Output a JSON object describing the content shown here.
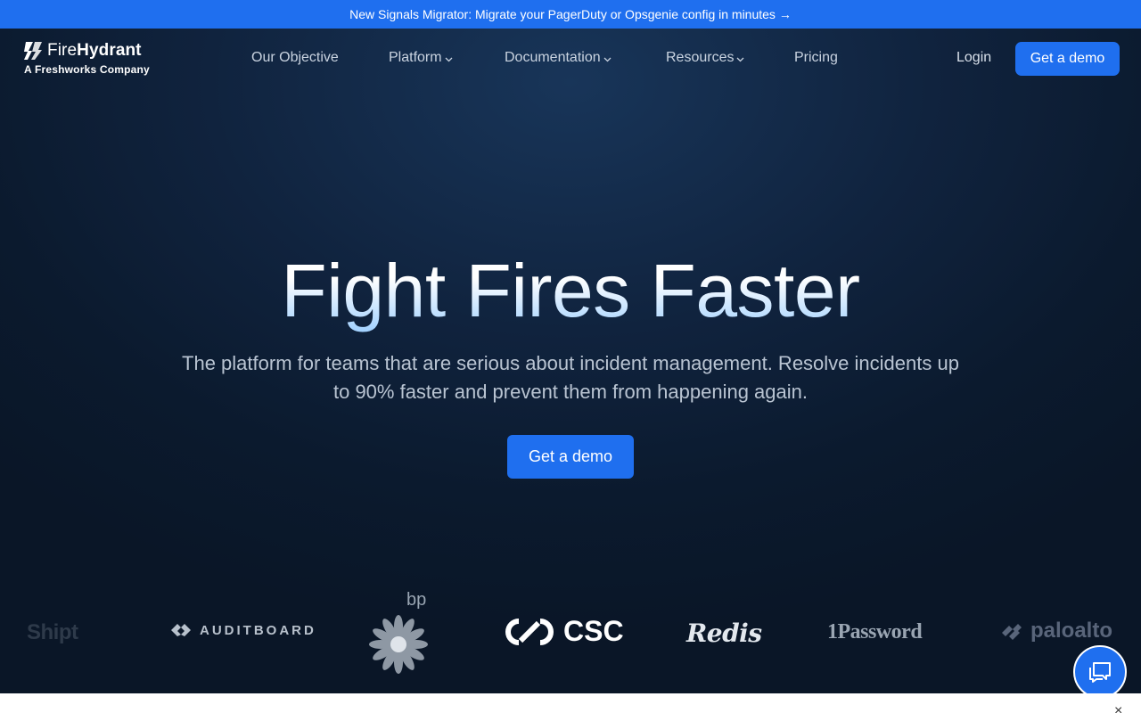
{
  "announcement": {
    "text": "New Signals Migrator: Migrate your PagerDuty or Opsgenie config in minutes →"
  },
  "brand": {
    "name_light": "Fire",
    "name_bold": "Hydrant",
    "tagline": "A Freshworks Company"
  },
  "nav": {
    "items": [
      {
        "label": "Our Objective",
        "has_menu": false
      },
      {
        "label": "Platform",
        "has_menu": true
      },
      {
        "label": "Documentation",
        "has_menu": true
      },
      {
        "label": "Resources",
        "has_menu": true
      },
      {
        "label": "Pricing",
        "has_menu": false
      }
    ],
    "login": "Login",
    "cta": "Get a demo"
  },
  "hero": {
    "title": "Fight Fires Faster",
    "subtitle": "The platform for teams that are serious about incident management. Resolve incidents up to 90% faster and prevent them from happening again.",
    "cta": "Get a demo"
  },
  "customer_logos": {
    "shipt": "Shipt",
    "auditboard": "AUDITBOARD",
    "bp": "bp",
    "csc": "CSC",
    "redis": "Redis",
    "onepassword": "1Password",
    "paloalto": "paloalto"
  },
  "chat": {
    "icon": "chat-bubbles-icon"
  },
  "cookie_banner": {
    "close": "×"
  },
  "colors": {
    "accent": "#1f6fef",
    "background": "#0b1728"
  }
}
